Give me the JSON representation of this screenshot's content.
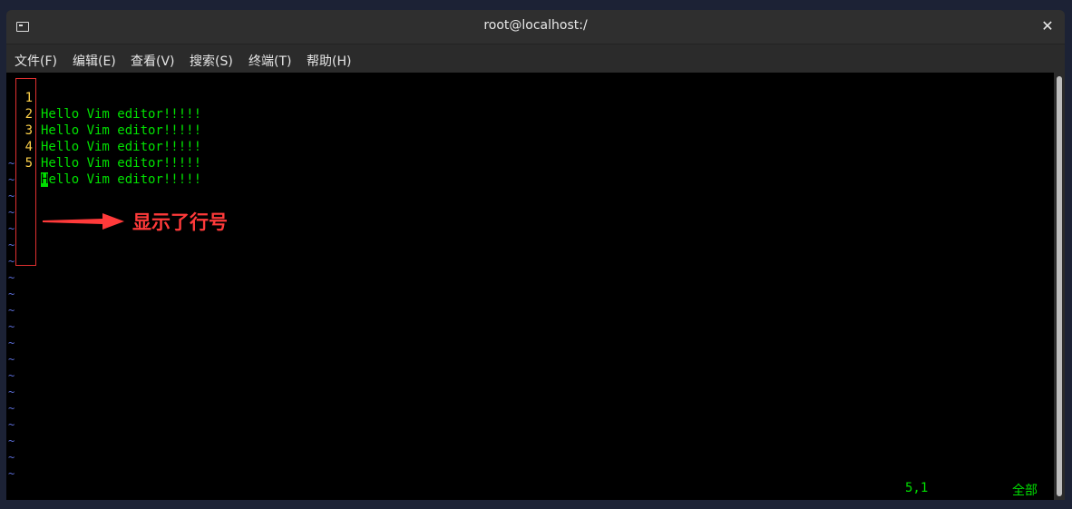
{
  "window": {
    "title": "root@localhost:/",
    "close_glyph": "✕"
  },
  "menu": [
    {
      "label": "文件(F)"
    },
    {
      "label": "编辑(E)"
    },
    {
      "label": "查看(V)"
    },
    {
      "label": "搜索(S)"
    },
    {
      "label": "终端(T)"
    },
    {
      "label": "帮助(H)"
    }
  ],
  "editor": {
    "lines": [
      {
        "num": "1",
        "text": "Hello Vim editor!!!!!"
      },
      {
        "num": "2",
        "text": "Hello Vim editor!!!!!"
      },
      {
        "num": "3",
        "text": "Hello Vim editor!!!!!"
      },
      {
        "num": "4",
        "text": "Hello Vim editor!!!!!"
      },
      {
        "num": "5",
        "cursor_char": "H",
        "text_rest": "ello Vim editor!!!!!"
      }
    ],
    "tilde": "~",
    "tilde_count": 20,
    "status_position": "5,1",
    "status_scope": "全部"
  },
  "annotation": {
    "text": "显示了行号",
    "color": "#ff3a3a"
  },
  "colors": {
    "text": "#00e000",
    "line_number": "#ffd24a",
    "tilde": "#5a6cd6",
    "background": "#000000"
  }
}
